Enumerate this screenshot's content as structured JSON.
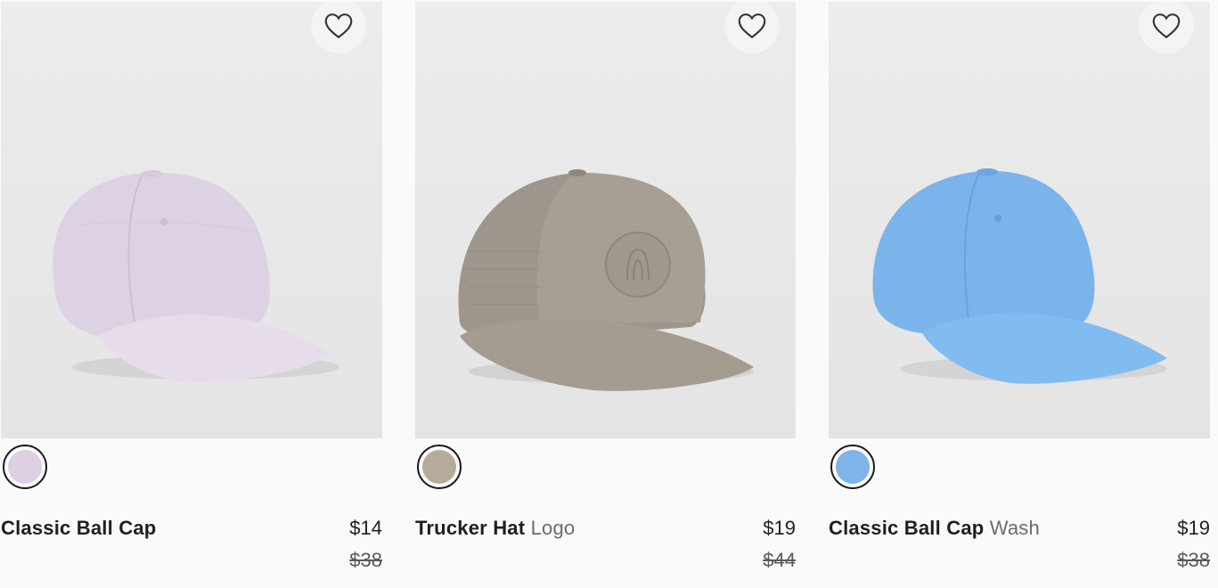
{
  "products": [
    {
      "name": "Classic Ball Cap",
      "subtitle": "",
      "price_now": "$14",
      "price_was": "$38",
      "swatch_color": "#ddd0e3",
      "cap_color": "#ded3e4",
      "wishlist_icon": "heart-outline-icon"
    },
    {
      "name": "Trucker Hat",
      "subtitle": "Logo",
      "price_now": "$19",
      "price_was": "$44",
      "swatch_color": "#b5ab9a",
      "cap_color": "#a59d92",
      "wishlist_icon": "heart-outline-icon"
    },
    {
      "name": "Classic Ball Cap",
      "subtitle": "Wash",
      "price_now": "$19",
      "price_was": "$38",
      "swatch_color": "#7fb3ea",
      "cap_color": "#7db6ec",
      "wishlist_icon": "heart-outline-icon"
    }
  ]
}
